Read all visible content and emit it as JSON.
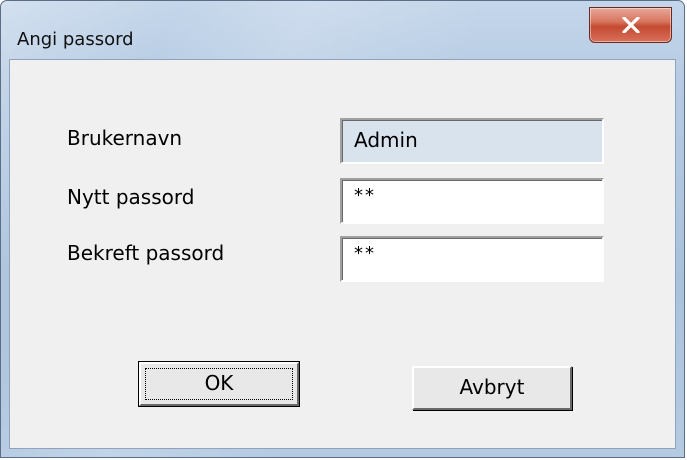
{
  "window": {
    "title": "Angi passord",
    "close_icon": "close-icon",
    "accent_close": "#c44a32"
  },
  "form": {
    "username_label": "Brukernavn",
    "username_value": "Admin",
    "new_password_label": "Nytt passord",
    "new_password_value": "**",
    "confirm_password_label": "Bekreft passord",
    "confirm_password_value": "**"
  },
  "buttons": {
    "ok_label": "OK",
    "cancel_label": "Avbryt"
  }
}
